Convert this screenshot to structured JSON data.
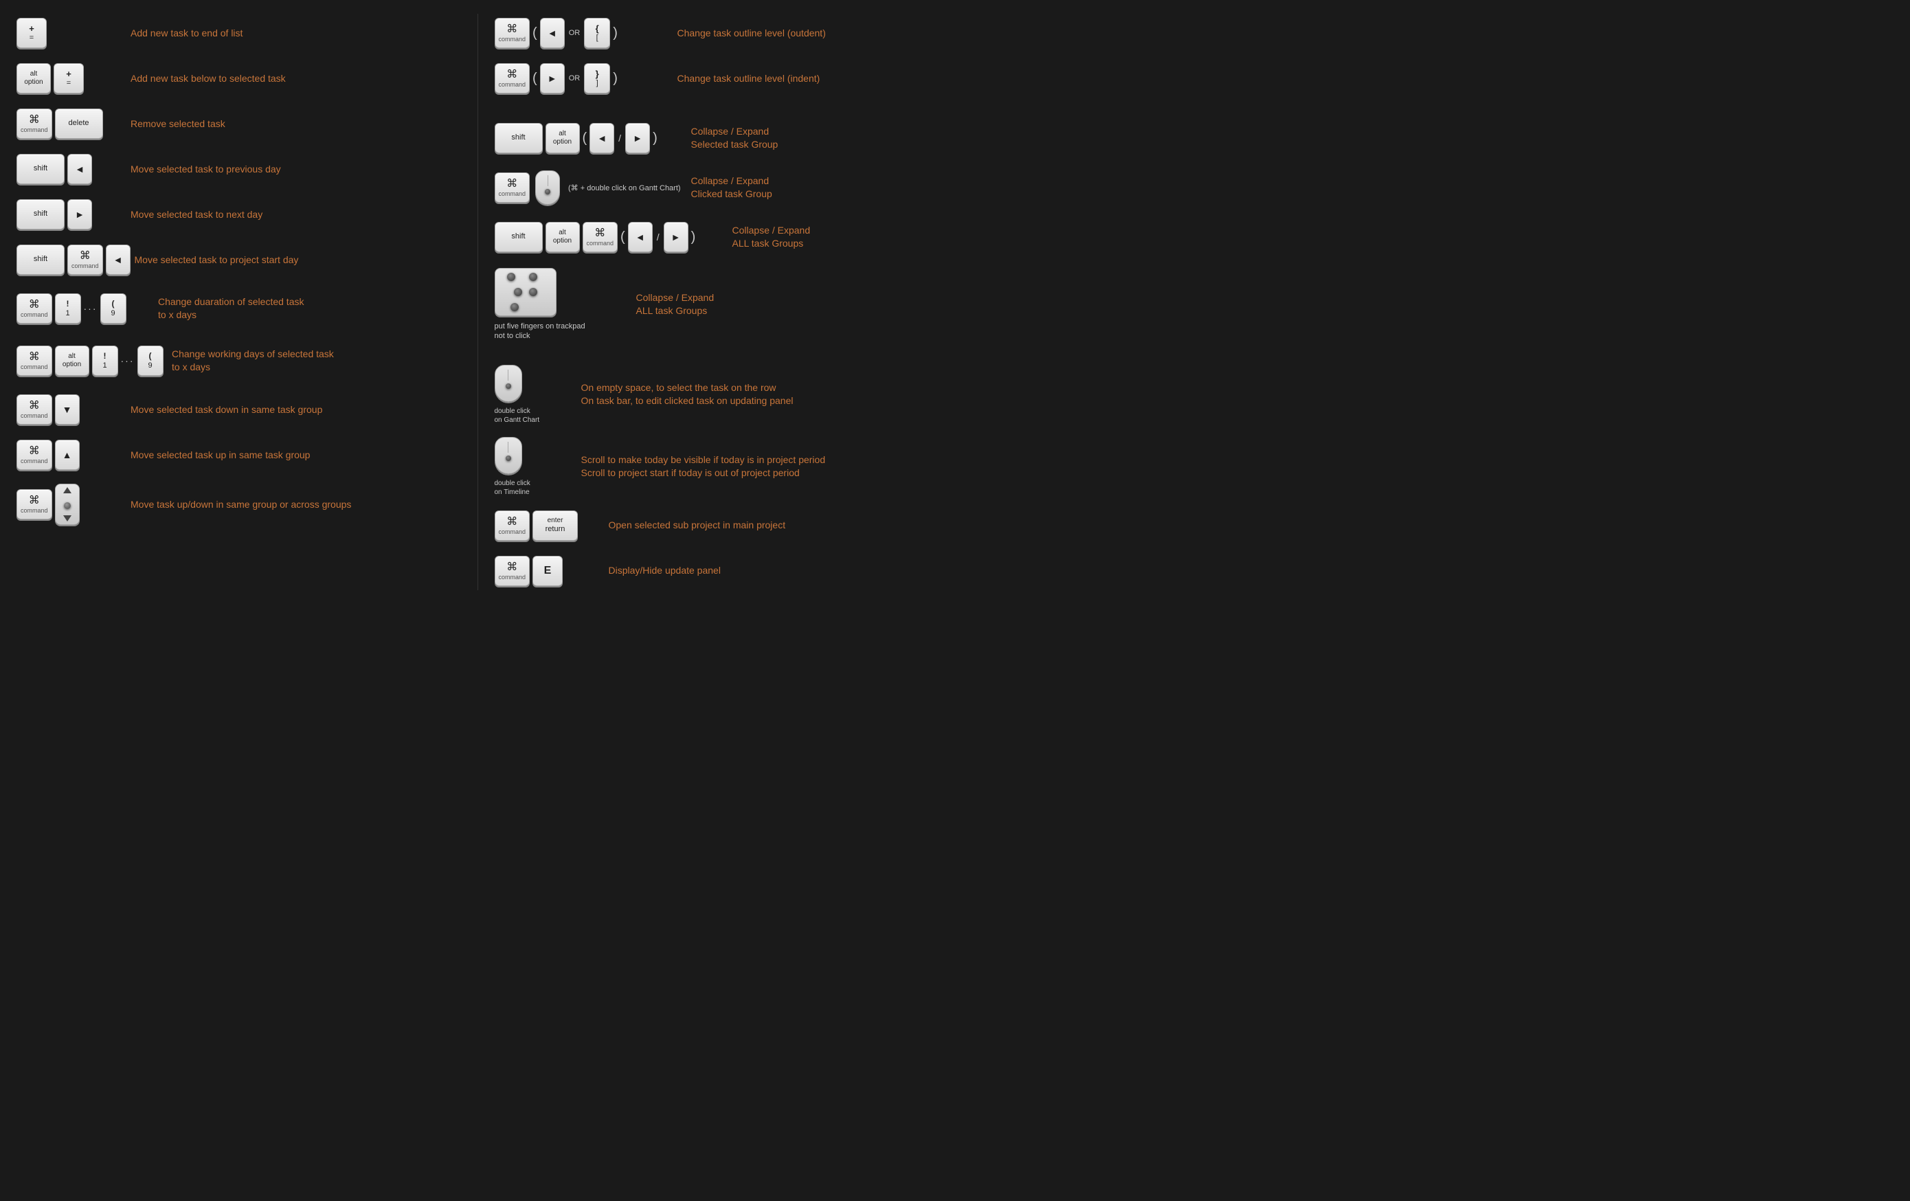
{
  "left": {
    "rows": [
      {
        "id": "add-end",
        "desc": "Add new task to end of list",
        "keys": [
          {
            "label": "+",
            "sub": "=",
            "type": "stacked"
          }
        ]
      },
      {
        "id": "add-below",
        "desc": "Add new task below to selected task",
        "keys": [
          {
            "sym": "alt",
            "sub": "option",
            "type": "alt"
          },
          {
            "label": "+",
            "sub": "=",
            "type": "stacked"
          }
        ]
      },
      {
        "id": "remove",
        "desc": "Remove selected task",
        "keys": [
          {
            "sym": "⌘",
            "sub": "command",
            "type": "cmd"
          },
          {
            "label": "delete",
            "type": "wide"
          }
        ]
      },
      {
        "id": "prev-day",
        "desc": "Move selected task to previous day",
        "keys": [
          {
            "label": "shift",
            "type": "wide"
          },
          {
            "sym": "◄",
            "type": "arrow"
          }
        ]
      },
      {
        "id": "next-day",
        "desc": "Move selected task to next day",
        "keys": [
          {
            "label": "shift",
            "type": "wide"
          },
          {
            "sym": "►",
            "type": "arrow"
          }
        ]
      },
      {
        "id": "project-start",
        "desc": "Move selected task to project start day",
        "keys": [
          {
            "label": "shift",
            "type": "wide"
          },
          {
            "sym": "⌘",
            "sub": "command",
            "type": "cmd"
          },
          {
            "sym": "◄",
            "type": "arrow"
          }
        ]
      },
      {
        "id": "duration",
        "desc": "Change duaration of selected task\nto x days",
        "keys": [
          {
            "sym": "⌘",
            "sub": "command",
            "type": "cmd"
          },
          {
            "label": "!",
            "sub": "1",
            "type": "stacked"
          },
          {
            "dots": "..."
          },
          {
            "label": "(",
            "sub": "9",
            "type": "stacked"
          }
        ]
      },
      {
        "id": "working-days",
        "desc": "Change working days of selected task\nto x days",
        "keys": [
          {
            "sym": "⌘",
            "sub": "command",
            "type": "cmd"
          },
          {
            "sym": "alt",
            "sub": "option",
            "type": "alt"
          },
          {
            "label": "!",
            "sub": "1",
            "type": "stacked"
          },
          {
            "dots": "..."
          },
          {
            "label": "(",
            "sub": "9",
            "type": "stacked"
          }
        ]
      },
      {
        "id": "move-down",
        "desc": "Move selected task down in same task group",
        "keys": [
          {
            "sym": "⌘",
            "sub": "command",
            "type": "cmd"
          },
          {
            "sym": "▼",
            "type": "arrow"
          }
        ]
      },
      {
        "id": "move-up",
        "desc": "Move selected task up in same task group",
        "keys": [
          {
            "sym": "⌘",
            "sub": "command",
            "type": "cmd"
          },
          {
            "sym": "▲",
            "type": "arrow"
          }
        ]
      },
      {
        "id": "move-updown",
        "desc": "Move task up/down in same group or across groups",
        "keys": [
          {
            "sym": "⌘",
            "sub": "command",
            "type": "cmd"
          },
          {
            "type": "mouse-updown"
          }
        ]
      }
    ]
  },
  "right": {
    "rows": [
      {
        "id": "outdent",
        "desc": "Change task outline level (outdent)",
        "keys": [
          {
            "sym": "⌘",
            "sub": "command",
            "type": "cmd"
          },
          {
            "paren": "("
          },
          {
            "sym": "◄",
            "type": "arrow"
          },
          {
            "or": "OR"
          },
          {
            "label": "{",
            "sub": "[",
            "type": "stacked"
          },
          {
            "paren": ")"
          }
        ]
      },
      {
        "id": "indent",
        "desc": "Change task outline level (indent)",
        "keys": [
          {
            "sym": "⌘",
            "sub": "command",
            "type": "cmd"
          },
          {
            "paren": "("
          },
          {
            "sym": "►",
            "type": "arrow"
          },
          {
            "or": "OR"
          },
          {
            "label": "}",
            "sub": "]",
            "type": "stacked"
          },
          {
            "paren": ")"
          }
        ]
      },
      {
        "id": "collapse-selected",
        "desc": "Collapse / Expand\nSelected task Group",
        "keys": [
          {
            "label": "shift",
            "type": "wide"
          },
          {
            "sym": "alt",
            "sub": "option",
            "type": "alt"
          },
          {
            "paren": "("
          },
          {
            "sym": "◄",
            "type": "arrow"
          },
          {
            "slash": "/"
          },
          {
            "sym": "►",
            "type": "arrow"
          },
          {
            "paren": ")"
          }
        ]
      },
      {
        "id": "collapse-clicked",
        "desc": "Collapse / Expand\nClicked task Group",
        "keys": [
          {
            "sym": "⌘",
            "sub": "command",
            "type": "cmd"
          },
          {
            "type": "mouse-dot"
          },
          {
            "gantt-label": "(⌘ + double click on Gantt Chart)"
          }
        ]
      },
      {
        "id": "collapse-all",
        "desc": "Collapse / Expand\nALL task Groups",
        "keys": [
          {
            "label": "shift",
            "type": "wide"
          },
          {
            "sym": "alt",
            "sub": "option",
            "type": "alt"
          },
          {
            "sym": "⌘",
            "sub": "command",
            "type": "cmd"
          },
          {
            "paren": "("
          },
          {
            "sym": "◄",
            "type": "arrow"
          },
          {
            "slash": "/"
          },
          {
            "sym": "►",
            "type": "arrow"
          },
          {
            "paren": ")"
          }
        ]
      },
      {
        "id": "collapse-trackpad",
        "desc": "Collapse / Expand\nALL task Groups",
        "keys": [
          {
            "type": "trackpad"
          }
        ],
        "trackpad-label": "put five fingers on trackpad\nnot to click"
      },
      {
        "id": "dbl-gantt",
        "desc": "On empty space, to select the task on the row\nOn task bar,  to edit clicked task on updating panel",
        "keys": [
          {
            "type": "mouse-gantt",
            "label": "double click\non Gantt Chart"
          }
        ]
      },
      {
        "id": "dbl-timeline",
        "desc": "Scroll to make today be visible if today is in project period\nScroll to project start if today is out of project period",
        "keys": [
          {
            "type": "mouse-timeline",
            "label": "double click\non Timeline"
          }
        ]
      },
      {
        "id": "open-sub",
        "desc": "Open selected sub project in main project",
        "keys": [
          {
            "sym": "⌘",
            "sub": "command",
            "type": "cmd"
          },
          {
            "label": "enter",
            "sub": "return",
            "type": "enter"
          }
        ]
      },
      {
        "id": "display-panel",
        "desc": "Display/Hide update panel",
        "keys": [
          {
            "sym": "⌘",
            "sub": "command",
            "type": "cmd"
          },
          {
            "label": "E",
            "type": "letter"
          }
        ]
      }
    ]
  }
}
